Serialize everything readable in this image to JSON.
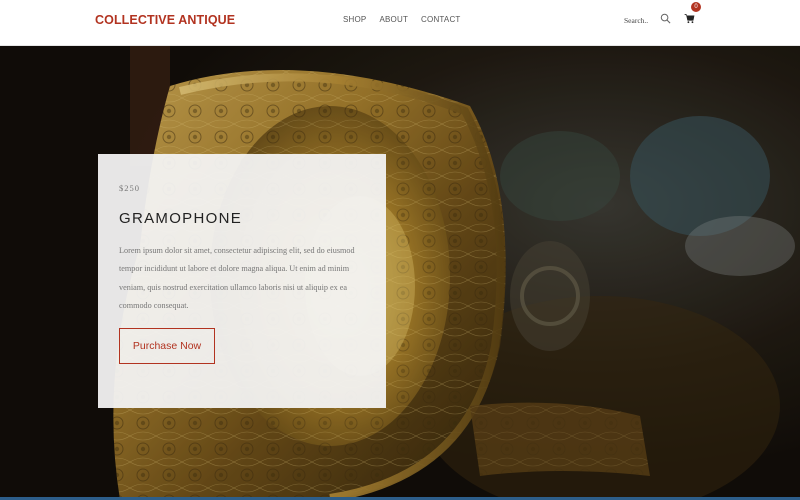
{
  "brand": {
    "name": "COLLECTIVE ANTIQUE",
    "color": "#b23320"
  },
  "nav": [
    {
      "label": "SHOP"
    },
    {
      "label": "ABOUT"
    },
    {
      "label": "CONTACT"
    }
  ],
  "search": {
    "placeholder": "Search.."
  },
  "cart": {
    "count": "0"
  },
  "hero": {
    "image": "gramophone-horn-photo"
  },
  "product": {
    "price": "$250",
    "title": "GRAMOPHONE",
    "description": "Lorem ipsum dolor sit amet, consectetur adipiscing elit, sed do eiusmod tempor incididunt ut labore et dolore magna aliqua. Ut enim ad minim veniam, quis nostrud exercitation ullamco laboris nisi ut aliquip ex ea commodo consequat.",
    "cta_label": "Purchase Now"
  }
}
